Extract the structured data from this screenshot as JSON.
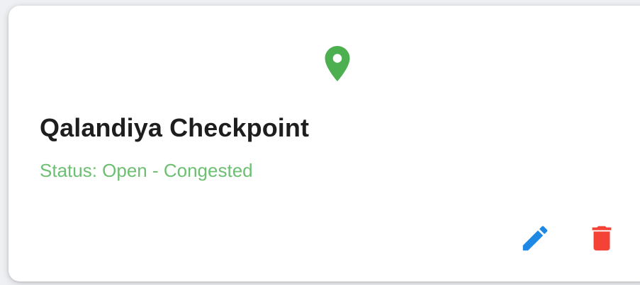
{
  "card": {
    "title": "Qalandiya Checkpoint",
    "status_text": "Status: Open - Congested",
    "icons": {
      "location": "location-pin-icon",
      "edit": "edit-pencil-icon",
      "delete": "trash-icon"
    },
    "colors": {
      "pin": "#4caf50",
      "status": "#6dbf72",
      "edit": "#1e88e5",
      "delete": "#f44336"
    }
  }
}
